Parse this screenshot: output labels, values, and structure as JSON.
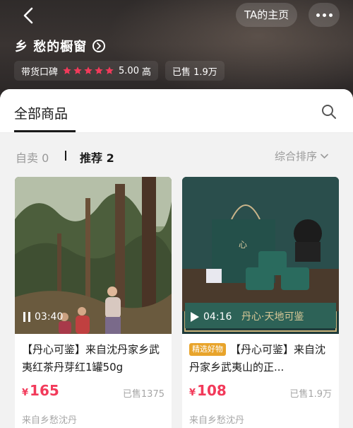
{
  "header": {
    "ta_home_label": "TA的主页",
    "shop_name": "乡  愁的橱窗",
    "rating_label": "带货口碑",
    "rating_score": "5.00",
    "rating_level": "高",
    "rating_stars": 5,
    "sold_label": "已售 1.9万"
  },
  "tabs": {
    "all_label": "全部商品"
  },
  "filters": {
    "self_label": "自卖 0",
    "recommend_label": "推荐 2",
    "sort_label": "综合排序"
  },
  "products": [
    {
      "duration": "03:40",
      "title": "【丹心可鉴】来自沈丹家乡武夷红茶丹芽红1罐50g",
      "badge": "",
      "currency": "¥",
      "price": "165",
      "sold": "已售1375",
      "from": "来自乡愁沈丹"
    },
    {
      "duration": "04:16",
      "title": "【丹心可鉴】来自沈丹家乡武夷山的正...",
      "badge": "精选好物",
      "currency": "¥",
      "price": "108",
      "sold": "已售1.9万",
      "from": "来自乡愁沈丹",
      "overlay_text": "丹心·天地可鉴"
    }
  ],
  "colors": {
    "accent_price": "#f23a5a",
    "star": "#f23a5a",
    "badge": "#e8a42b",
    "header_bg": "#2f2b2a"
  },
  "icons": [
    "back-arrow-icon",
    "more-dots-icon",
    "arrow-right-circle-icon",
    "star-icon",
    "search-icon",
    "chevron-down-icon",
    "pause-icon",
    "play-icon"
  ]
}
